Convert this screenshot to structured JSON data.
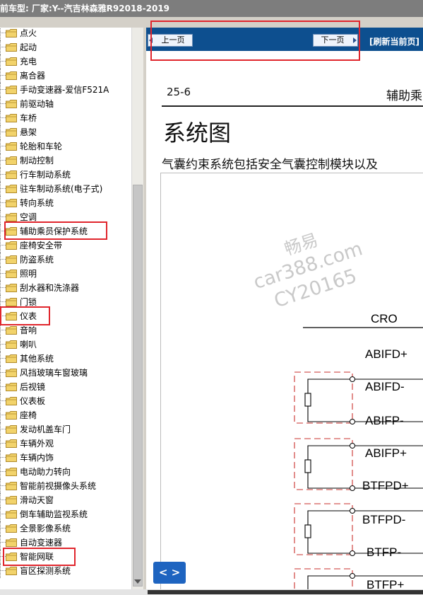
{
  "app": {
    "title": "前车型:  厂家:Y--汽吉林森雅R92018-2019"
  },
  "tree": {
    "items": [
      "点火",
      "起动",
      "充电",
      "离合器",
      "手动变速器-爱信F521A",
      "前驱动轴",
      "车桥",
      "悬架",
      "轮胎和车轮",
      "制动控制",
      "行车制动系统",
      "驻车制动系统(电子式)",
      "转向系统",
      "空调",
      "辅助乘员保护系统",
      "座椅安全带",
      "防盗系统",
      "照明",
      "刮水器和洗涤器",
      "门锁",
      "仪表",
      "音响",
      "喇叭",
      "其他系统",
      "风挡玻璃车窗玻璃",
      "后视镜",
      "仪表板",
      "座椅",
      "发动机盖车门",
      "车辆外观",
      "车辆内饰",
      "电动助力转向",
      "智能前视摄像头系统",
      "滑动天窗",
      "倒车辅助监视系统",
      "全景影像系统",
      "自动变速器",
      "智能网联",
      "盲区探测系统"
    ]
  },
  "nav": {
    "prev_label": "上一页",
    "next_label": "下一页",
    "refresh_label": "[刷新当前页]"
  },
  "page": {
    "number": "25-6",
    "header": "辅助乘",
    "title": "系统图",
    "intro": "气囊约束系统包括安全气囊控制模块以及"
  },
  "diagram": {
    "labels": [
      "CRO",
      "ABIFD+",
      "ABIFD-",
      "ABIFP-",
      "ABIFP+",
      "BTFPD+",
      "BTFPD-",
      "BTFP-",
      "BTFP+"
    ]
  },
  "watermark": {
    "line1": "畅易",
    "line2": "car388.com",
    "line3": "CY20165"
  },
  "toggle": {
    "label": "< >"
  },
  "colors": {
    "nav_blue": "#0d4f8f",
    "highlight_red": "#e0262d",
    "folder_yellow": "#f2d36b",
    "dashed_red": "#c9302c"
  }
}
